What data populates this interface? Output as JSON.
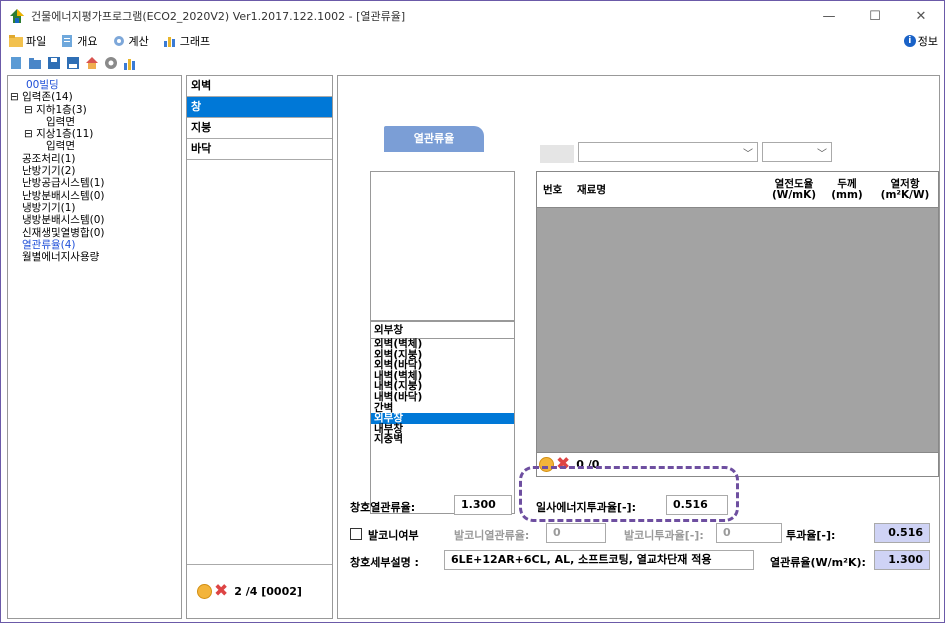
{
  "window": {
    "title": "건물에너지평가프로그램(ECO2_2020V2) Ver1.2017.122.1002 - [열관류율]",
    "min": "—",
    "max": "☐",
    "close": "✕"
  },
  "menu": {
    "file": "파일",
    "overview": "개요",
    "calc": "계산",
    "graph": "그래프",
    "info": "정보"
  },
  "tree": {
    "items": [
      "00빌딩",
      "입력존(14)",
      "지하1층(3)",
      "입력면",
      "지상1층(11)",
      "입력면",
      "공조처리(1)",
      "난방기기(2)",
      "난방공급시스템(1)",
      "난방분배시스템(0)",
      "냉방기기(1)",
      "냉방분배시스템(0)",
      "신재생및열병합(0)",
      "열관류율(4)",
      "월별에너지사용량"
    ]
  },
  "categories": [
    "외벽",
    "창",
    "지붕",
    "바닥"
  ],
  "mid_footer": "2 /4 [0002]",
  "tab": "열관류율",
  "material_list": {
    "selected": "외부창",
    "options": [
      "외벽(벽체)",
      "외벽(지붕)",
      "외벽(바닥)",
      "내벽(벽체)",
      "내벽(지붕)",
      "내벽(바닥)",
      "간벽",
      "외부창",
      "내부창",
      "지중벽"
    ]
  },
  "table": {
    "col_no": "번호",
    "col_name": "재료명",
    "col_cond1": "열전도율",
    "col_cond2": "(W/mK)",
    "col_thick1": "두께",
    "col_thick2": "(mm)",
    "col_res1": "열저항",
    "col_res2": "(m²K/W)",
    "footer": "0 /0"
  },
  "form": {
    "window_u_label": "창호열관류율:",
    "window_u_value": "1.300",
    "solar_label": "일사에너지투과율[-]:",
    "solar_value": "0.516",
    "balcony_label": "발코니여부",
    "balcony_u_label": "발코니열관류율:",
    "balcony_u_value": "0",
    "balcony_trans_label": "발코니투과율[-]:",
    "balcony_trans_value": "0",
    "trans_label": "투과율[-]:",
    "trans_value": "0.516",
    "desc_label": "창호세부설명 :",
    "desc_value": "6LE+12AR+6CL, AL, 소프트코팅, 열교차단재 적용",
    "u_label": "열관류율(W/m²K):",
    "u_value": "1.300"
  }
}
